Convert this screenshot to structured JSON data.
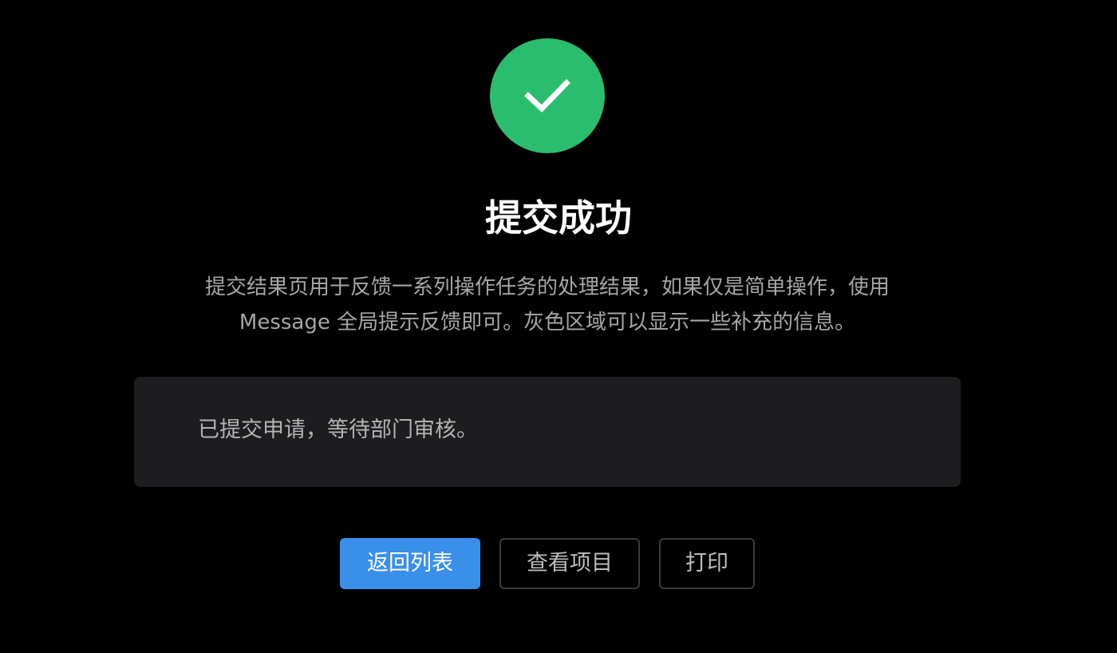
{
  "result": {
    "status_icon": "check-icon",
    "status_color": "#2bbd6e",
    "title": "提交成功",
    "description": "提交结果页用于反馈一系列操作任务的处理结果，如果仅是简单操作，使用 Message 全局提示反馈即可。灰色区域可以显示一些补充的信息。"
  },
  "panel": {
    "text": "已提交申请，等待部门审核。",
    "background": "#1d1d1f"
  },
  "actions": {
    "back_label": "返回列表",
    "view_label": "查看项目",
    "print_label": "打印",
    "primary_color": "#3a8fea"
  }
}
